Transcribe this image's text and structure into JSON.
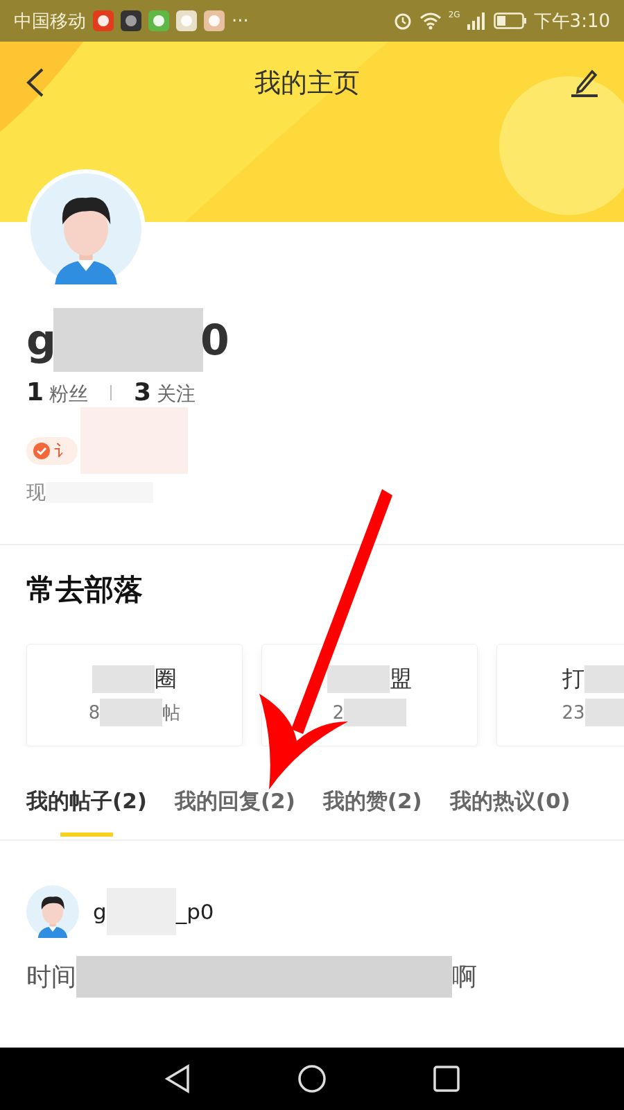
{
  "status_bar": {
    "carrier": "中国移动",
    "more": "···",
    "network": "2G",
    "time": "下午3:10"
  },
  "header": {
    "title": "我的主页"
  },
  "profile": {
    "name_start": "g",
    "name_end": "0",
    "followers_count": "1",
    "followers_label": "粉丝",
    "following_count": "3",
    "following_label": "关注",
    "badge_text": "讠",
    "location_text": "现"
  },
  "tribes": {
    "title": "常去部落",
    "cards": [
      {
        "title_end": "圈",
        "sub_start": "8",
        "sub_end": "帖"
      },
      {
        "title_end": "盟",
        "sub_start": "2"
      },
      {
        "title_start": "打",
        "sub_start": "23"
      }
    ]
  },
  "tabs": [
    {
      "label": "我的帖子(2)",
      "selected": true
    },
    {
      "label": "我的回复(2)",
      "selected": false
    },
    {
      "label": "我的赞(2)",
      "selected": false
    },
    {
      "label": "我的热议(0)",
      "selected": false
    }
  ],
  "post": {
    "author_start": "g",
    "author_end": "_p0",
    "text_start": "时间",
    "text_end": "啊"
  }
}
